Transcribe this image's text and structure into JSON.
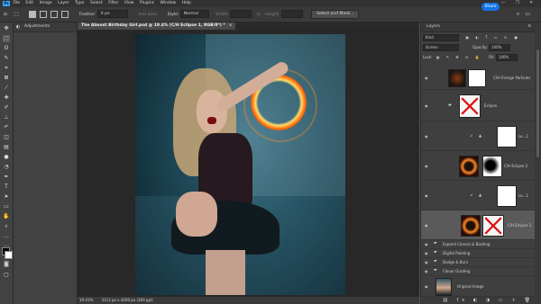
{
  "menubar": {
    "app_badge": "Ps",
    "items": [
      "File",
      "Edit",
      "Image",
      "Layer",
      "Type",
      "Select",
      "Filter",
      "View",
      "Plugins",
      "Window",
      "Help"
    ],
    "window_controls": "— ❐ ✕"
  },
  "options": {
    "feather_label": "Feather:",
    "feather_value": "0 px",
    "antialias_label": "Anti-alias",
    "style_label": "Style:",
    "style_value": "Normal",
    "width_label": "Width:",
    "height_label": "Height:",
    "select_mask_label": "Select and Mask...",
    "share_label": "Share"
  },
  "adjustments": {
    "title": "Adjustments"
  },
  "document": {
    "tab_title": "The Almost Birthday Girl.psd @ 19.4% (C/H Eclipse 1, RGB/8*) *",
    "close": "×"
  },
  "status": {
    "zoom": "19.41%",
    "size": "3113 px x 4200 px (300 ppi)"
  },
  "layers": {
    "title": "Layers",
    "filter_kind": "Kind",
    "blend_mode": "Screen",
    "opacity_label": "Opacity:",
    "opacity_value": "100%",
    "lock_label": "Lock:",
    "fill_label": "Fill:",
    "fill_value": "100%",
    "rows": {
      "orange_particles": "C/H Orange Particles",
      "eclipse_group": "Eclipse",
      "levels_1": "Le...1",
      "eclipse_2": "C/H Eclipse 2",
      "levels_2": "Le...1",
      "eclipse_1": "C/H Eclipse 1",
      "expand_canvas": "Expand Canvas & Backing",
      "digital_painting": "Digital Painting",
      "dodge_burn": "Dodge & Burn",
      "colour_grading": "Colour Grading",
      "original_image": "Original Image"
    },
    "footer_icons": "⛓ fx ◐ ◑ ▭ ＋ 🗑"
  },
  "colors": {
    "accent": "#1473e6",
    "ps_blue": "#31a8ff",
    "panel": "#424242",
    "selected_layer": "#5a5a5a"
  }
}
